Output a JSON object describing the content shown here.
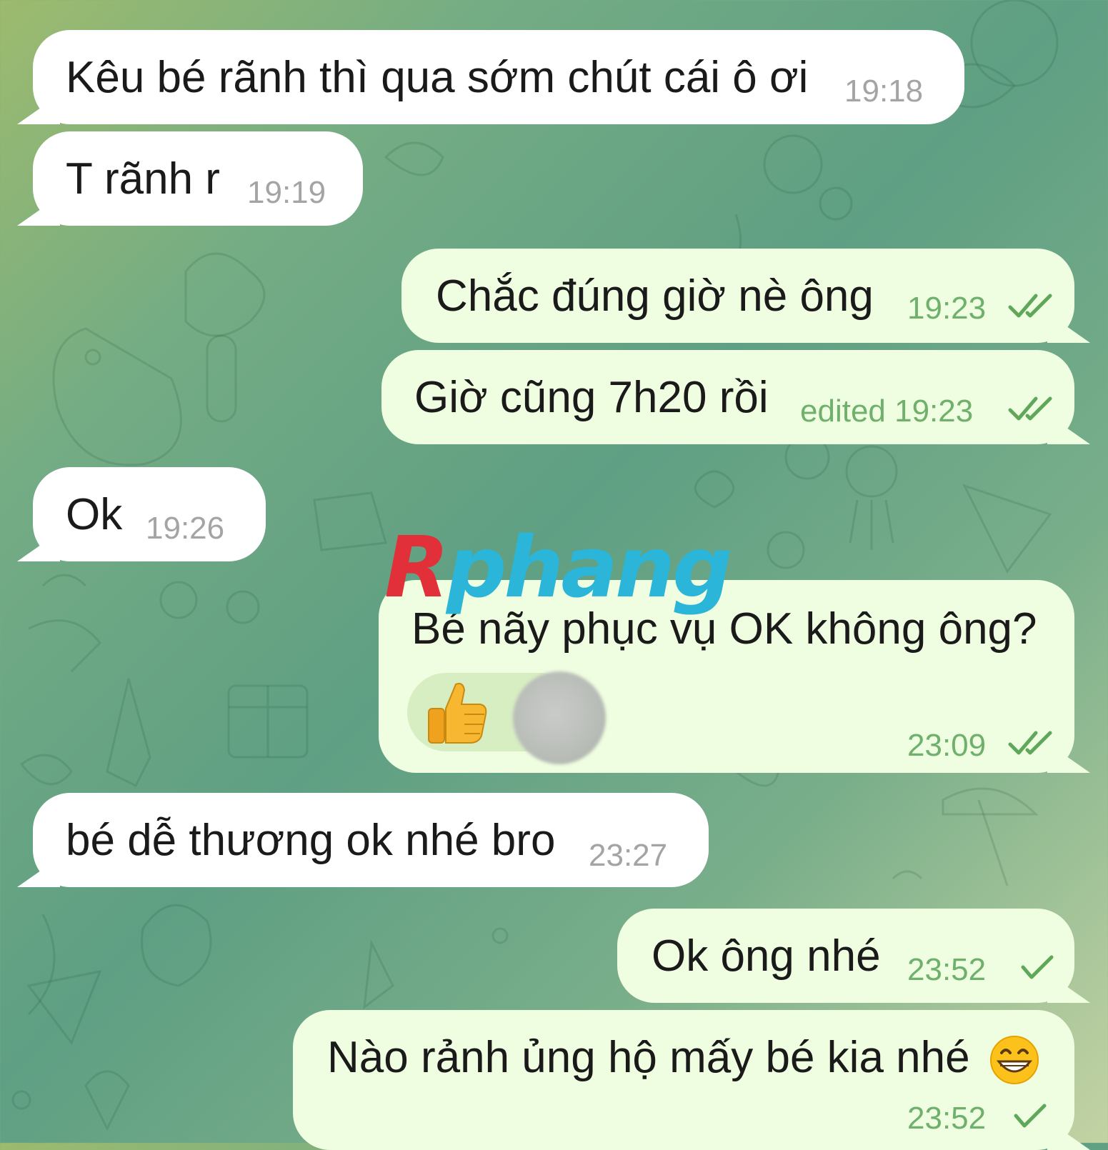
{
  "messages": [
    {
      "id": 1,
      "direction": "incoming",
      "text": "Kêu bé rãnh thì qua sớm chút cái ô ơi",
      "time": "19:18"
    },
    {
      "id": 2,
      "direction": "incoming",
      "text": "T rãnh r",
      "time": "19:19"
    },
    {
      "id": 3,
      "direction": "outgoing",
      "text": "Chắc đúng giờ nè ông",
      "time": "19:23",
      "status": "read"
    },
    {
      "id": 4,
      "direction": "outgoing",
      "text": "Giờ cũng 7h20 rồi",
      "time": "edited 19:23",
      "status": "read"
    },
    {
      "id": 5,
      "direction": "incoming",
      "text": "Ok",
      "time": "19:26"
    },
    {
      "id": 6,
      "direction": "outgoing",
      "text": "Bé nãy phục vụ OK không ông?",
      "time": "23:09",
      "status": "read",
      "reaction": {
        "emoji_icon": "thumbs-up-icon",
        "reactor": "blurred-avatar"
      }
    },
    {
      "id": 7,
      "direction": "incoming",
      "text": "bé dễ thương ok nhé bro",
      "time": "23:27"
    },
    {
      "id": 8,
      "direction": "outgoing",
      "text": "Ok ông nhé",
      "time": "23:52",
      "status": "sent"
    },
    {
      "id": 9,
      "direction": "outgoing",
      "text": "Nào rảnh ủng hộ mấy bé kia nhé",
      "emoji_icon": "grinning-face-icon",
      "time": "23:52",
      "status": "sent"
    }
  ],
  "watermark": {
    "first": "R",
    "rest": "phang"
  },
  "colors": {
    "incoming_bubble": "#ffffff",
    "outgoing_bubble": "#effde0",
    "outgoing_meta": "#6fb06c",
    "incoming_meta": "#a4a4a4",
    "watermark_red": "#e2303a",
    "watermark_cyan": "#2bb5d9"
  }
}
